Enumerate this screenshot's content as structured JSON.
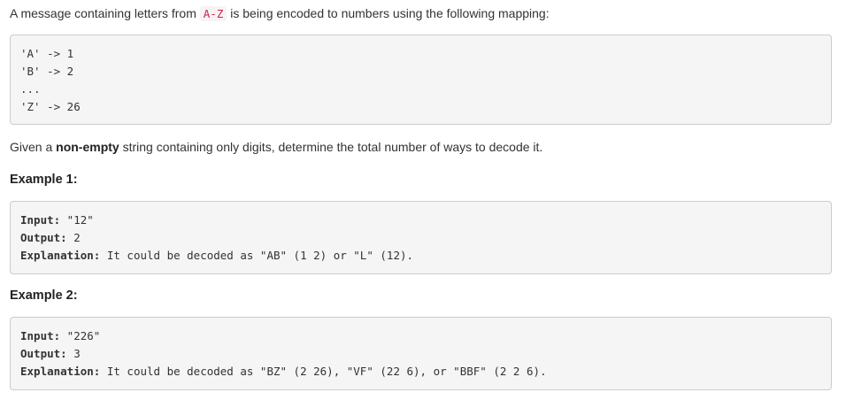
{
  "intro": {
    "prefix": "A message containing letters from ",
    "code": "A-Z",
    "suffix": " is being encoded to numbers using the following mapping:"
  },
  "mapping_block": [
    "'A' -> 1",
    "'B' -> 2",
    "...",
    "'Z' -> 26"
  ],
  "task": {
    "prefix": "Given a ",
    "bold": "non-empty",
    "suffix": " string containing only digits, determine the total number of ways to decode it."
  },
  "examples": [
    {
      "heading": "Example 1:",
      "input_label": "Input:",
      "input_value": " \"12\"",
      "output_label": "Output:",
      "output_value": " 2",
      "explanation_label": "Explanation:",
      "explanation_value": " It could be decoded as \"AB\" (1 2) or \"L\" (12)."
    },
    {
      "heading": "Example 2:",
      "input_label": "Input:",
      "input_value": " \"226\"",
      "output_label": "Output:",
      "output_value": " 3",
      "explanation_label": "Explanation:",
      "explanation_value": " It could be decoded as \"BZ\" (2 26), \"VF\" (22 6), or \"BBF\" (2 2 6)."
    }
  ]
}
